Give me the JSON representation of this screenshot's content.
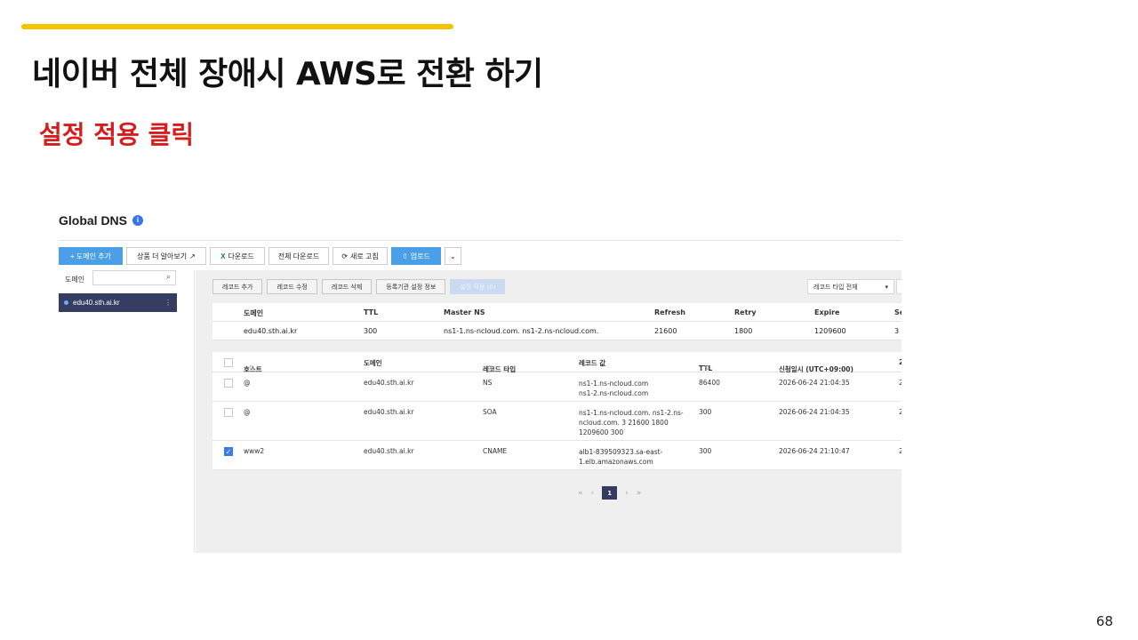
{
  "slide": {
    "title": "네이버 전체 장애시 AWS로 전환 하기",
    "subtitle": "설정 적용 클릭",
    "page_number": "68",
    "accent_color": "#f5c400",
    "subtitle_color": "#d81c1c"
  },
  "app": {
    "title": "Global DNS",
    "info_badge": "i"
  },
  "toolbar": {
    "add_domain": "+ 도메인 추가",
    "learn_more": "상품 더 알아보기",
    "download": "다운로드",
    "download_all": "전체 다운로드",
    "refresh": "새로 고침",
    "upload": "업로드"
  },
  "sidebar": {
    "search_label": "도메인",
    "search_placeholder": "",
    "selected_domain": "edu40.sth.ai.kr"
  },
  "record_toolbar": {
    "add": "레코드 추가",
    "edit": "레코드 수정",
    "delete": "레코드 삭제",
    "registrar": "등록기관 설정 정보",
    "apply": "설정 적용 (0)",
    "type_filter": "레코드 타입 전체"
  },
  "domain_info": {
    "headers": [
      "도메인",
      "TTL",
      "Master NS",
      "Refresh",
      "Retry",
      "Expire",
      "Se"
    ],
    "values": [
      "edu40.sth.ai.kr",
      "300",
      "ns1-1.ns-ncloud.com. ns1-2.ns-ncloud.com.",
      "21600",
      "1800",
      "1209600",
      "3"
    ]
  },
  "records": {
    "headers": [
      "호스트",
      "도메인",
      "레코드 타입",
      "레코드 값",
      "TTL",
      "신청일시 (UTC+09:00)",
      "2"
    ],
    "rows": [
      {
        "host": "@",
        "domain": "edu40.sth.ai.kr",
        "type": "NS",
        "value": "ns1-1.ns-ncloud.com ns1-2.ns-ncloud.com",
        "ttl": "86400",
        "date": "2026-06-24 21:04:35",
        "extra": "2",
        "checked": false
      },
      {
        "host": "@",
        "domain": "edu40.sth.ai.kr",
        "type": "SOA",
        "value": "ns1-1.ns-ncloud.com. ns1-2.ns-ncloud.com. 3 21600 1800 1209600 300",
        "ttl": "300",
        "date": "2026-06-24 21:04:35",
        "extra": "2",
        "checked": false
      },
      {
        "host": "www2",
        "domain": "edu40.sth.ai.kr",
        "type": "CNAME",
        "value": "alb1-839509323.sa-east-1.elb.amazonaws.com",
        "ttl": "300",
        "date": "2026-06-24 21:10:47",
        "extra": "2",
        "checked": true
      }
    ]
  },
  "pager": {
    "current": "1"
  }
}
